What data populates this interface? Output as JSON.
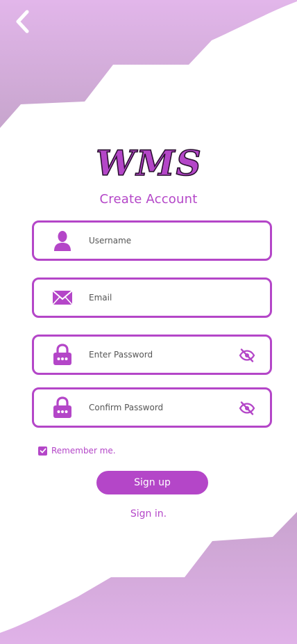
{
  "app": {
    "logo_text": "WMS",
    "title": "Create Account"
  },
  "form": {
    "username": {
      "placeholder": "Username",
      "value": ""
    },
    "email": {
      "placeholder": "Email",
      "value": ""
    },
    "password": {
      "placeholder": "Enter Password",
      "value": ""
    },
    "confirm_password": {
      "placeholder": "Confirm Password",
      "value": ""
    },
    "remember_label": "Remember me.",
    "remember_checked": true
  },
  "actions": {
    "signup_label": "Sign up",
    "signin_label": "Sign in."
  },
  "icons": {
    "back": "chevron-left-icon",
    "username": "user-icon",
    "email": "envelope-icon",
    "password": "lock-icon",
    "visibility": "eye-off-icon",
    "checkbox": "check-icon"
  },
  "colors": {
    "accent": "#b446c8",
    "shape_light": "#e0b2e8",
    "shape_dark": "#c9a3cf",
    "background": "#ffffff",
    "button_text": "#ffffff"
  }
}
